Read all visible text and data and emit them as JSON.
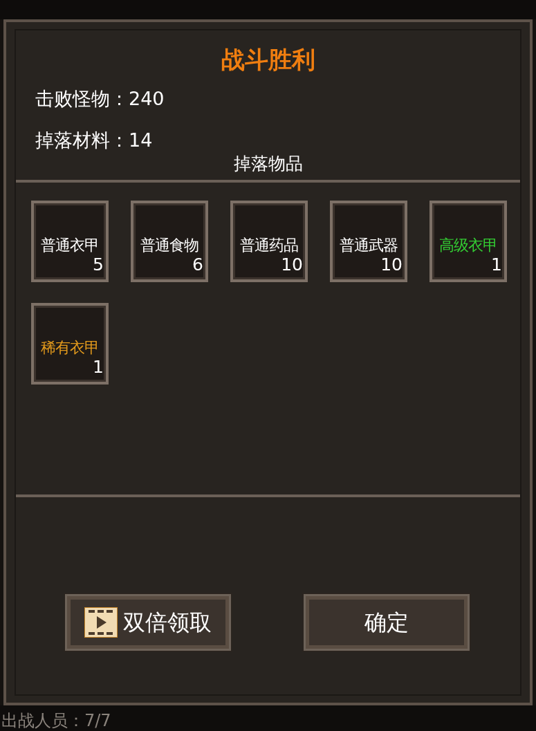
{
  "dialog": {
    "title": "战斗胜利",
    "stats": [
      {
        "label": "击败怪物：",
        "value": "240"
      },
      {
        "label": "掉落材料：",
        "value": "14"
      }
    ],
    "section_title": "掉落物品",
    "items": [
      {
        "name": "普通衣甲",
        "count": "5",
        "color": "#ffffff"
      },
      {
        "name": "普通食物",
        "count": "6",
        "color": "#ffffff"
      },
      {
        "name": "普通药品",
        "count": "10",
        "color": "#ffffff"
      },
      {
        "name": "普通武器",
        "count": "10",
        "color": "#ffffff"
      },
      {
        "name": "高级衣甲",
        "count": "1",
        "color": "#33cc33"
      },
      {
        "name": "稀有衣甲",
        "count": "1",
        "color": "#e39a1c"
      }
    ],
    "buttons": [
      {
        "label": "双倍领取",
        "kind": "video"
      },
      {
        "label": "确定",
        "kind": "plain"
      }
    ]
  },
  "footer": {
    "text": "出战人员：7/7"
  }
}
